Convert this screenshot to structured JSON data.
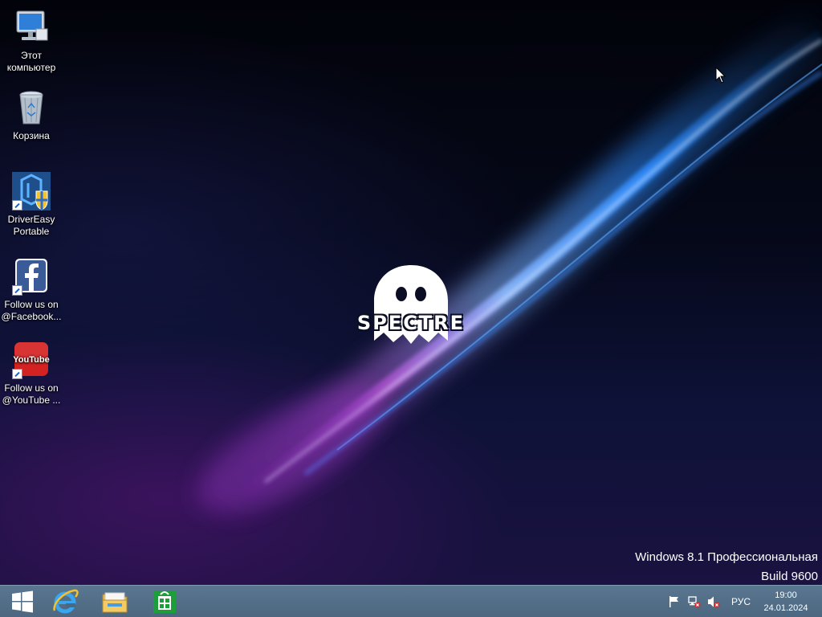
{
  "desktop": {
    "icons": [
      {
        "label_line1": "Этот",
        "label_line2": "компьютер",
        "icon": "computer-icon"
      },
      {
        "label_line1": "Корзина",
        "label_line2": "",
        "icon": "recycle-bin-icon"
      },
      {
        "label_line1": "DriverEasy",
        "label_line2": "Portable",
        "icon": "drivereasy-icon"
      },
      {
        "label_line1": "Follow us on",
        "label_line2": "@Facebook...",
        "icon": "facebook-icon"
      },
      {
        "label_line1": "Follow us on",
        "label_line2": "@YouTube ...",
        "icon": "youtube-icon"
      }
    ],
    "logo_text": "SPECTRE",
    "watermark": {
      "edition": "Windows 8.1 Профессиональная",
      "build": "Build 9600"
    }
  },
  "taskbar": {
    "pinned": [
      {
        "name": "start-button",
        "icon": "windows-logo-icon"
      },
      {
        "name": "internet-explorer",
        "icon": "ie-icon"
      },
      {
        "name": "file-explorer",
        "icon": "folder-icon"
      },
      {
        "name": "store",
        "icon": "store-icon"
      }
    ],
    "tray": {
      "icons": [
        "action-center-flag-icon",
        "network-disconnected-icon",
        "volume-muted-icon"
      ],
      "language": "РУС",
      "time": "19:00",
      "date": "24.01.2024"
    }
  },
  "colors": {
    "taskbar": "#4c677f",
    "light_streak": "#3aa0ff",
    "purple_glow": "#b04cd6"
  }
}
